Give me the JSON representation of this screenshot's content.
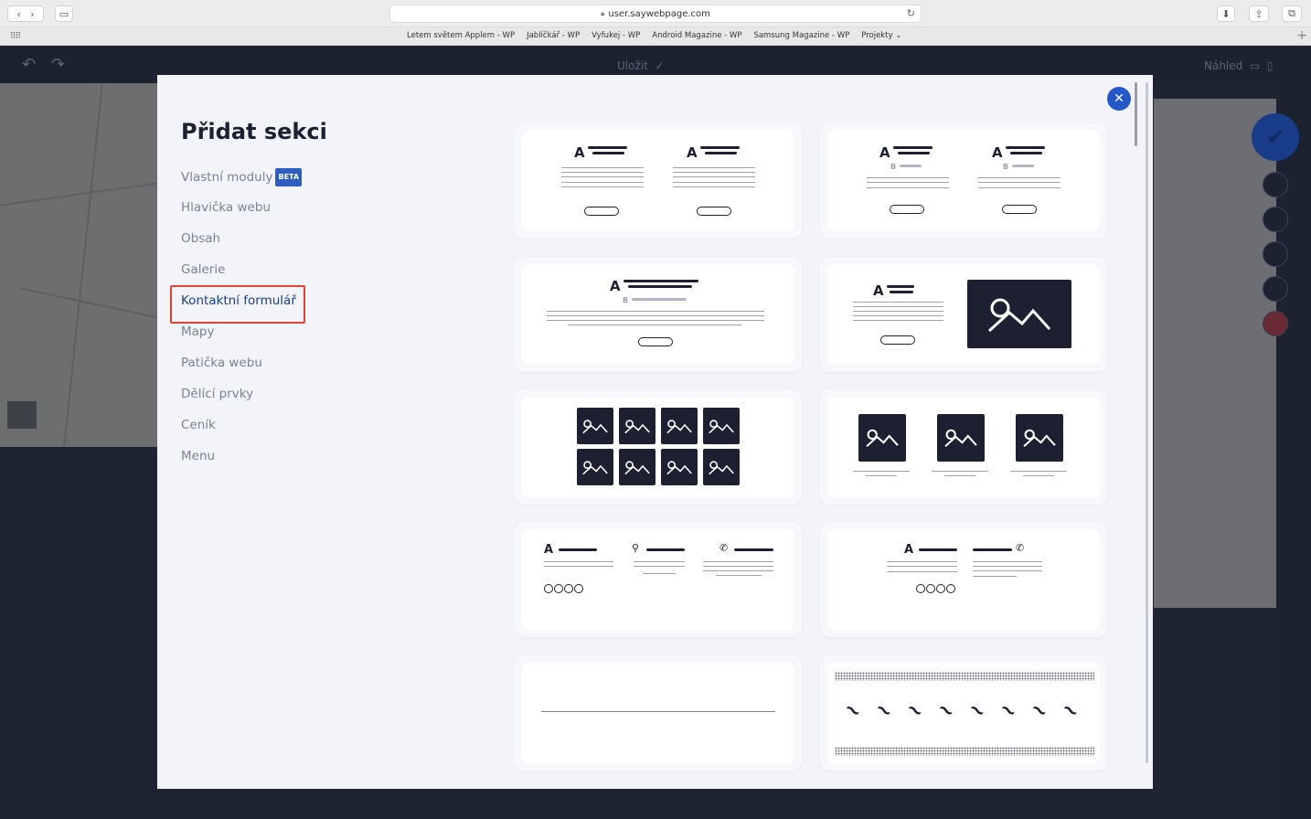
{
  "browser": {
    "url": "user.saywebpage.com",
    "favorites": [
      "Letem světem Applem - WP",
      "Jablíčkář - WP",
      "Vyfukej - WP",
      "Android Magazine - WP",
      "Samsung Magazine - WP",
      "Projekty ⌄"
    ]
  },
  "editor": {
    "save_label": "Uložit",
    "preview_label": "Náhled"
  },
  "modal": {
    "title": "Přidat sekci",
    "nav": [
      {
        "label": "Vlastní moduly",
        "badge": "BETA"
      },
      {
        "label": "Hlavička webu"
      },
      {
        "label": "Obsah"
      },
      {
        "label": "Galerie"
      },
      {
        "label": "Kontaktní formulář",
        "active": true
      },
      {
        "label": "Mapy"
      },
      {
        "label": "Patička webu"
      },
      {
        "label": "Dělící prvky"
      },
      {
        "label": "Ceník"
      },
      {
        "label": "Menu"
      }
    ],
    "thumb_labels": {
      "a": "A",
      "b": "B"
    },
    "close_icon": "close-icon"
  },
  "colors": {
    "accent": "#2657c6",
    "highlight": "#e2432f",
    "dark": "#1c2030"
  }
}
